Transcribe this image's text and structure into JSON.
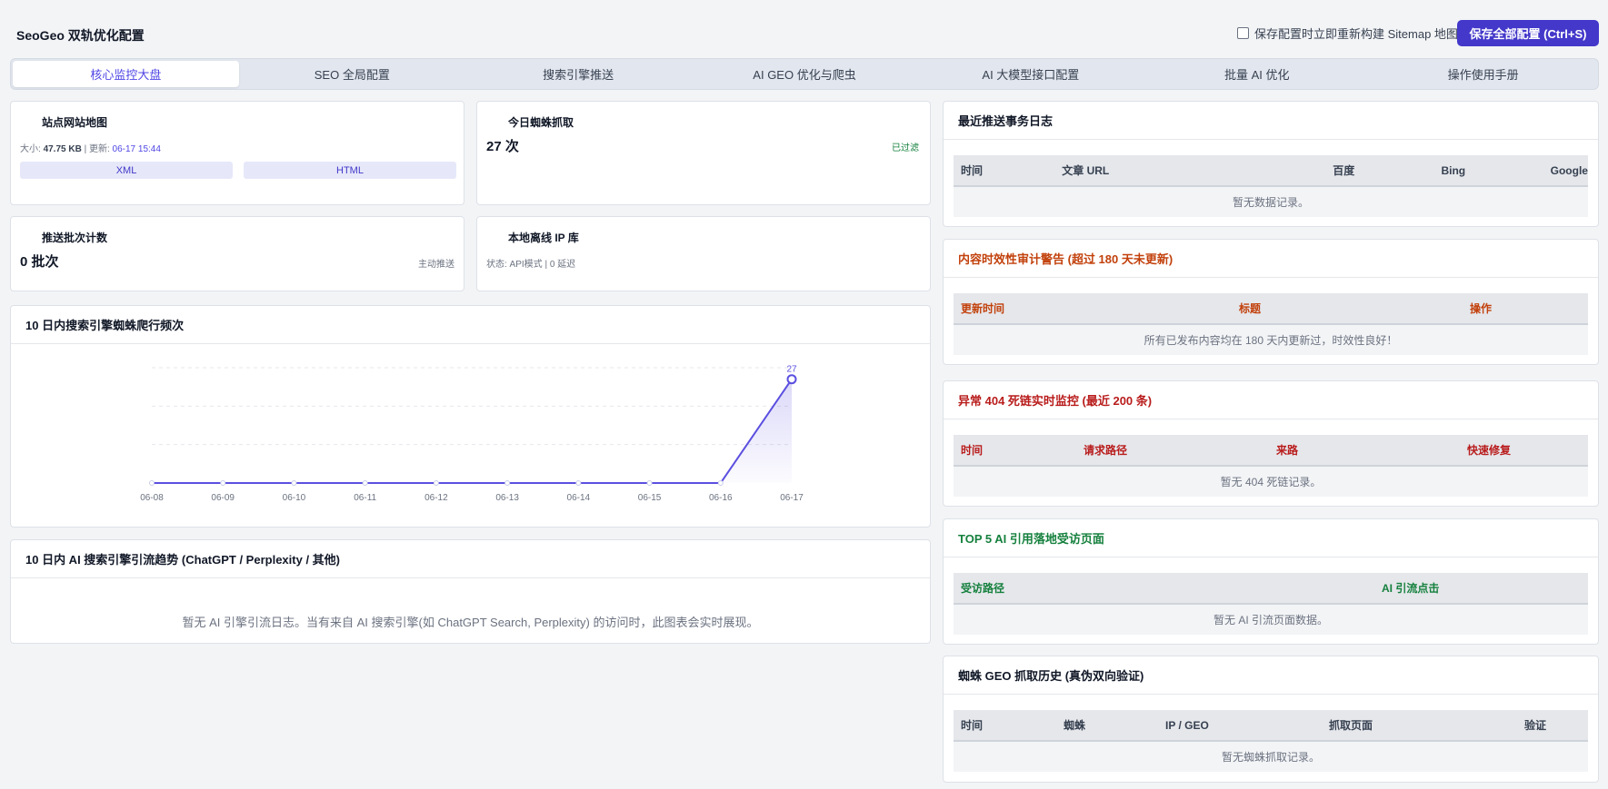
{
  "app": {
    "title": "SeoGeo 双轨优化配置",
    "rebuild_label": "保存配置时立即重新构建 Sitemap 地图",
    "save_label": "保存全部配置 (Ctrl+S)"
  },
  "tabs": [
    {
      "label": "核心监控大盘",
      "active": true
    },
    {
      "label": "SEO 全局配置"
    },
    {
      "label": "搜索引擎推送"
    },
    {
      "label": "AI GEO 优化与爬虫"
    },
    {
      "label": "AI 大模型接口配置"
    },
    {
      "label": "批量 AI 优化"
    },
    {
      "label": "操作使用手册"
    }
  ],
  "stats": {
    "sitemap": {
      "label": "站点网站地图",
      "size_prefix": "大小:",
      "size": "47.75 KB",
      "update_prefix": "| 更新:",
      "updated": "06-17 15:44",
      "xml": "XML",
      "html": "HTML"
    },
    "spider_today": {
      "label": "今日蜘蛛抓取",
      "value": "27 次",
      "badge": "已过滤"
    },
    "push_count": {
      "label": "推送批次计数",
      "value": "0 批次",
      "badge": "主动推送"
    },
    "ip_db": {
      "label": "本地离线 IP 库",
      "status": "状态: API模式 | 0 延迟"
    }
  },
  "crawl_chart": {
    "title": "10 日内搜索引擎蜘蛛爬行频次"
  },
  "chart_data": {
    "type": "area",
    "x": [
      "06-08",
      "06-09",
      "06-10",
      "06-11",
      "06-12",
      "06-13",
      "06-14",
      "06-15",
      "06-16",
      "06-17"
    ],
    "values": [
      0,
      0,
      0,
      0,
      0,
      0,
      0,
      0,
      0,
      27
    ],
    "data_labels": [
      "27"
    ],
    "title": "10 日内搜索引擎蜘蛛爬行频次",
    "ylim": [
      0,
      30
    ],
    "grid": true,
    "color": "#5b4fe0"
  },
  "ai_trend": {
    "title": "10 日内 AI 搜索引擎引流趋势 (ChatGPT / Perplexity / 其他)",
    "empty": "暂无 AI 引擎引流日志。当有来自 AI 搜索引擎(如 ChatGPT Search, Perplexity) 的访问时，此图表会实时展现。"
  },
  "push_log": {
    "title": "最近推送事务日志",
    "columns": [
      "时间",
      "文章 URL",
      "百度",
      "Bing",
      "Google"
    ],
    "empty": "暂无数据记录。"
  },
  "freshness": {
    "title": "内容时效性审计警告 (超过 180 天未更新)",
    "columns": [
      "更新时间",
      "标题",
      "操作"
    ],
    "empty": "所有已发布内容均在 180 天内更新过，时效性良好！"
  },
  "deadlinks": {
    "title": "异常 404 死链实时监控 (最近 200 条)",
    "columns": [
      "时间",
      "请求路径",
      "来路",
      "快速修复"
    ],
    "empty": "暂无 404 死链记录。"
  },
  "top_ai": {
    "title": "TOP 5 AI 引用落地受访页面",
    "columns": [
      "受访路径",
      "AI 引流点击"
    ],
    "empty": "暂无 AI 引流页面数据。"
  },
  "geo_history": {
    "title": "蜘蛛 GEO 抓取历史 (真伪双向验证)",
    "columns": [
      "时间",
      "蜘蛛",
      "IP / GEO",
      "抓取页面",
      "验证"
    ],
    "empty": "暂无蜘蛛抓取记录。"
  }
}
